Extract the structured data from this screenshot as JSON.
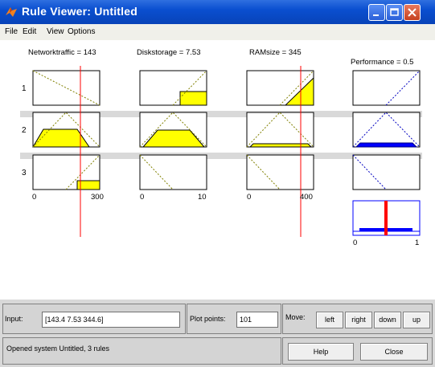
{
  "window": {
    "title": "Rule Viewer: Untitled"
  },
  "menu": [
    "File",
    "Edit",
    "View",
    "Options"
  ],
  "inputs": [
    {
      "label": "Networktraffic = 143",
      "min": "0",
      "max": "300",
      "value": 143
    },
    {
      "label": "Diskstorage = 7.53",
      "min": "0",
      "max": "10",
      "value": 7.53
    },
    {
      "label": "RAMsize = 345",
      "min": "0",
      "max": "400",
      "value": 345
    }
  ],
  "output": {
    "label": "Performance = 0.5",
    "min": "0",
    "max": "1",
    "value": 0.5
  },
  "rules": [
    "1",
    "2",
    "3"
  ],
  "controls": {
    "input_label": "Input:",
    "input_value": "[143.4 7.53 344.6]",
    "plot_points_label": "Plot points:",
    "plot_points_value": "101",
    "move_label": "Move:",
    "left": "left",
    "right": "right",
    "down": "down",
    "up": "up",
    "status": "Opened system Untitled, 3 rules",
    "help": "Help",
    "close": "Close"
  },
  "colors": {
    "title_bar": "#0a4fd0",
    "fill": "#ffff00",
    "index_line": "#ff0000",
    "output_fill": "#0000ff"
  }
}
